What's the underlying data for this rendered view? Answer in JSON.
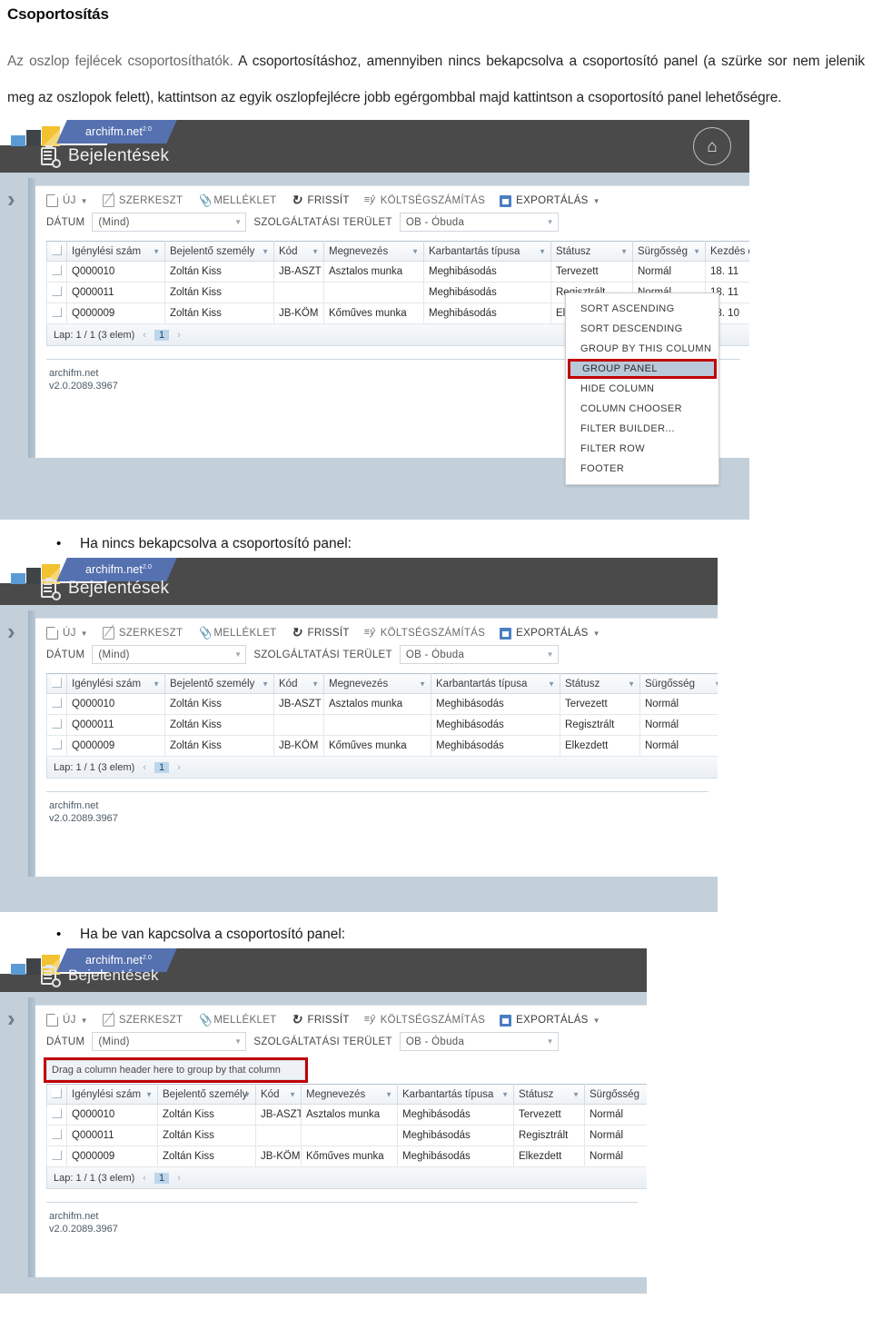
{
  "document": {
    "title": "Csoportosítás",
    "paragraph_lead": "Az oszlop fejlécek csoportosíthatók.",
    "paragraph_rest": " A csoportosításhoz, amennyiben nincs bekapcsolva a csoportosító panel (a szürke sor nem jelenik meg az oszlopok felett), kattintson az egyik oszlopfejlécre jobb egérgombbal majd kattintson a csoportosító panel lehetőségre.",
    "bullet_1": "Ha nincs bekapcsolva a csoportosító panel:",
    "bullet_2": "Ha be van kapcsolva a csoportosító panel:"
  },
  "app": {
    "brand": "archifm.net",
    "brand_sup": "2.0",
    "page_title": "Bejelentések",
    "home_icon": "home-icon",
    "toolbar": {
      "new": "ÚJ",
      "edit": "SZERKESZT",
      "attachment": "MELLÉKLET",
      "refresh": "FRISSÍT",
      "cost": "KÖLTSÉGSZÁMÍTÁS",
      "export": "EXPORTÁLÁS"
    },
    "filters": {
      "date_label": "DÁTUM",
      "date_value": "(Mind)",
      "area_label": "SZOLGÁLTATÁSI TERÜLET",
      "area_value": "OB - Óbuda"
    },
    "group_panel_hint": "Drag a column header here to group by that column",
    "footer": {
      "line1": "archifm.net",
      "line2": "v2.0.2089.3967"
    },
    "pager": {
      "label": "Lap: 1 / 1 (3 elem)",
      "prev": "‹",
      "page": "1",
      "next": "›"
    }
  },
  "grid": {
    "columns": [
      "Igénylési szám",
      "Bejelentő személy",
      "Kód",
      "Megnevezés",
      "Karbantartás típusa",
      "Státusz",
      "Sürgősség",
      "Kezdés dátuma"
    ],
    "rows": [
      {
        "igenylesi_szam": "Q000010",
        "bejelento": "Zoltán Kiss",
        "kod": "JB-ASZT",
        "megnevezes": "Asztalos munka",
        "karbantartas": "Meghibásodás",
        "statusz": "Tervezett",
        "surgosseg": "Normál",
        "kezdes": "18. 11"
      },
      {
        "igenylesi_szam": "Q000011",
        "bejelento": "Zoltán Kiss",
        "kod": "",
        "megnevezes": "",
        "karbantartas": "Meghibásodás",
        "statusz": "Regisztrált",
        "surgosseg": "Normál",
        "kezdes": "18. 11"
      },
      {
        "igenylesi_szam": "Q000009",
        "bejelento": "Zoltán Kiss",
        "kod": "JB-KÖM",
        "megnevezes": "Kőműves munka",
        "karbantartas": "Meghibásodás",
        "statusz": "Elkezdett",
        "surgosseg": "Normál",
        "kezdes": "18. 10"
      }
    ]
  },
  "context_menu": {
    "items": [
      "SORT ASCENDING",
      "SORT DESCENDING",
      "GROUP BY THIS COLUMN",
      "GROUP PANEL",
      "HIDE COLUMN",
      "COLUMN CHOOSER",
      "FILTER BUILDER...",
      "FILTER ROW",
      "FOOTER"
    ],
    "selected": "GROUP PANEL"
  },
  "colors": {
    "brand_tab": "#5671b0",
    "header_bar": "#4a4a4a",
    "status_tervezett": "#f8837f",
    "status_regisztralt": "#ffe84d",
    "status_elkezdett": "#9cc3ea",
    "type_cell": "#f8837f",
    "highlight_outline": "#c00000"
  }
}
